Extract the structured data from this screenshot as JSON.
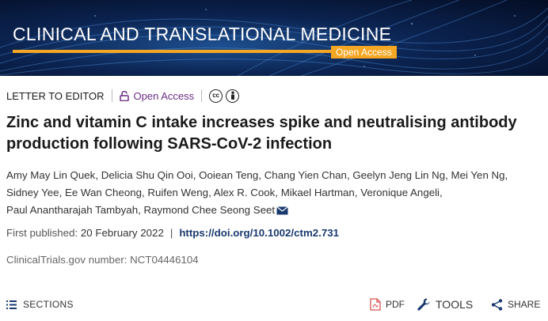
{
  "banner": {
    "journal_title": "CLINICAL AND TRANSLATIONAL MEDICINE",
    "badge": "Open Access"
  },
  "article_meta": {
    "type": "LETTER TO EDITOR",
    "access": "Open Access",
    "license_icons": [
      "cc-icon",
      "by-icon"
    ]
  },
  "title": "Zinc and vitamin C intake increases spike and neutralising antibody production following SARS-CoV-2 infection",
  "authors": [
    "Amy May Lin Quek",
    "Delicia Shu Qin Ooi",
    "Ooiean Teng",
    "Chang Yien Chan",
    "Geelyn Jeng Lin Ng",
    "Mei Yen Ng",
    "Sidney Yee",
    "Ee Wan Cheong",
    "Ruifen Weng",
    "Alex R. Cook",
    "Mikael Hartman",
    "Veronique Angeli",
    "Paul Anantharajah Tambyah",
    "Raymond Chee Seong Seet"
  ],
  "publication": {
    "label": "First published:",
    "date": "20 February 2022",
    "separator": "|",
    "doi": "https://doi.org/10.1002/ctm2.731"
  },
  "trial": "ClinicalTrials.gov number: NCT04446104",
  "toolbar": {
    "sections": "SECTIONS",
    "pdf": "PDF",
    "tools": "TOOLS",
    "share": "SHARE"
  },
  "colors": {
    "banner_bg": "#0b2350",
    "accent_orange": "#f5a623",
    "open_access_purple": "#6b2d83",
    "doi_link": "#1a3a6e",
    "pdf_red": "#d9534f"
  }
}
